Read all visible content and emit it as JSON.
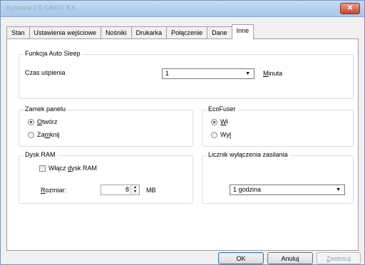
{
  "window": {
    "title": "Kyocera FS-C8600 KX",
    "close_glyph": "✕"
  },
  "tabs": [
    {
      "label": "Stan"
    },
    {
      "label": "Ustawienia wejściowe"
    },
    {
      "label": "Nośniki"
    },
    {
      "label": "Drukarka"
    },
    {
      "label": "Połączenie"
    },
    {
      "label": "Dane"
    },
    {
      "label": "Inne",
      "active": true
    }
  ],
  "auto_sleep": {
    "title": "Funkcja Auto Sleep",
    "label": "Czas uśpienia",
    "value": "1",
    "unit_pre": "",
    "unit_ul": "M",
    "unit_post": "inuta"
  },
  "panel_lock": {
    "title": "Zamek panelu",
    "opt1_ul": "O",
    "opt1_rest": "twórz",
    "opt2_pre": "Za",
    "opt2_ul": "m",
    "opt2_rest": "knij",
    "selected": "Otwórz"
  },
  "ecofuser": {
    "title": "EcoFuser",
    "opt1_ul": "W",
    "opt1_rest": "ł",
    "opt2_pre": "Wy",
    "opt2_ul": "ł",
    "opt2_rest": "",
    "selected": "Wł"
  },
  "ram_disk": {
    "title": "Dysk RAM",
    "checkbox_pre": "Włącz ",
    "checkbox_ul": "d",
    "checkbox_rest": "ysk RAM",
    "size_ul": "R",
    "size_rest": "ozmiar:",
    "size_value": "8",
    "size_unit": "MB"
  },
  "power_off": {
    "title": "Licznik wyłączenia zasilania",
    "value": "1 godzina"
  },
  "buttons": {
    "ok": "OK",
    "cancel": "Anuluj",
    "apply_ul": "Z",
    "apply_rest": "astosuj"
  }
}
